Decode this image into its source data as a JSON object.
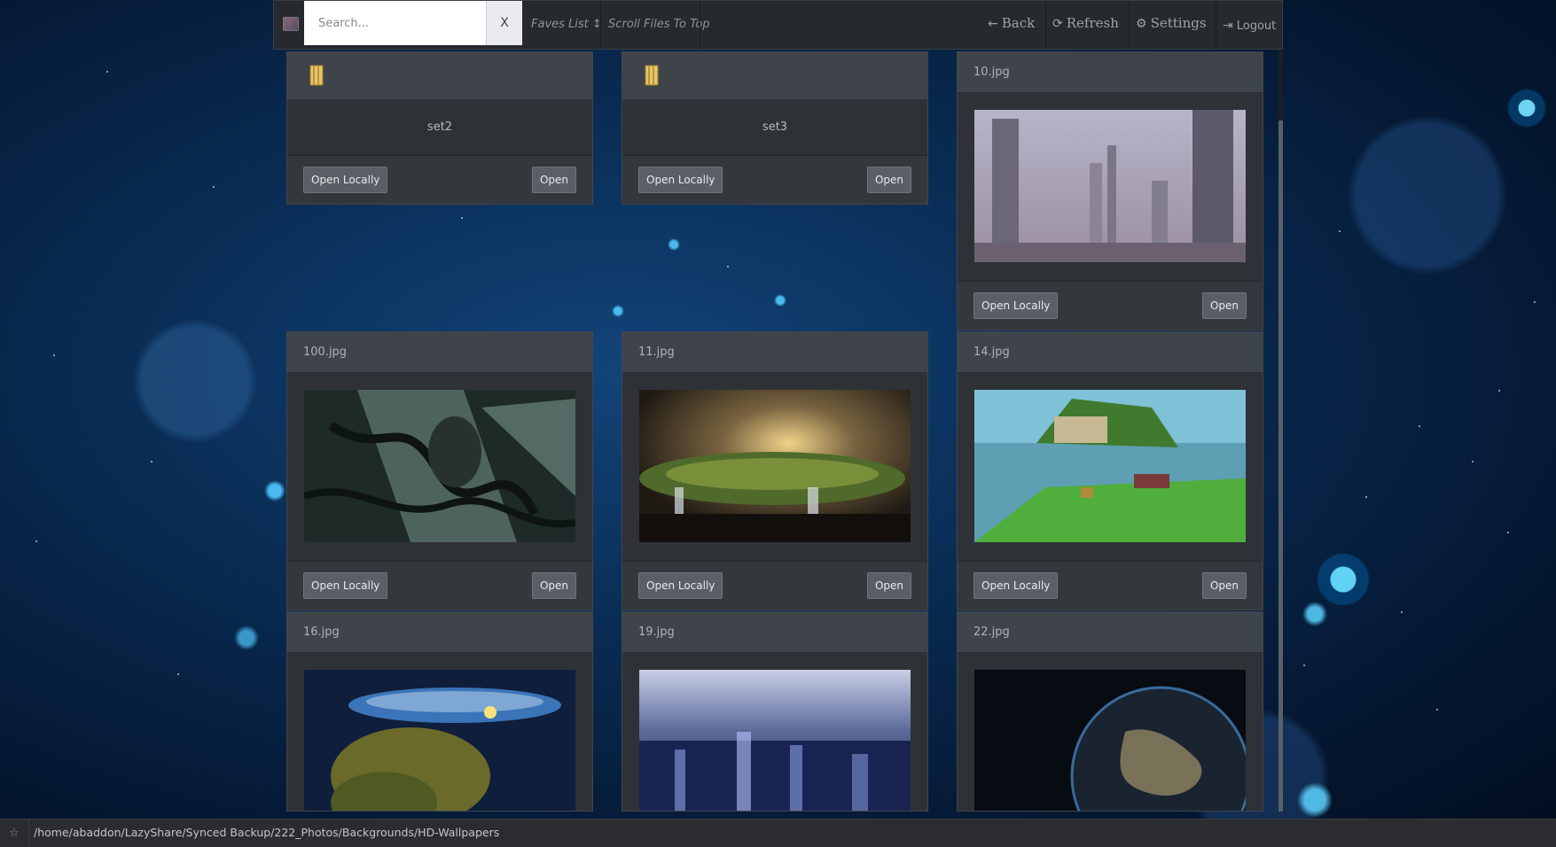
{
  "nav": {
    "search_placeholder": "Search...",
    "clear_label": "X",
    "faves_label": "Faves List ↕",
    "scroll_top_label": "Scroll Files To Top",
    "back_label": "Back",
    "refresh_label": "Refresh",
    "settings_label": "Settings",
    "logout_label": "Logout",
    "icons": {
      "back": "arrow-left-icon",
      "refresh": "refresh-icon",
      "settings": "gear-icon",
      "logout": "logout-icon"
    }
  },
  "cards": [
    {
      "kind": "folder",
      "name": "set2",
      "open_locally": "Open Locally",
      "open": "Open"
    },
    {
      "kind": "folder",
      "name": "set3",
      "open_locally": "Open Locally",
      "open": "Open"
    },
    {
      "kind": "image",
      "name": "10.jpg",
      "scene": "futuristic-city",
      "open_locally": "Open Locally",
      "open": "Open"
    },
    {
      "kind": "image",
      "name": "100.jpg",
      "scene": "dark-forest",
      "open_locally": "Open Locally",
      "open": "Open"
    },
    {
      "kind": "image",
      "name": "11.jpg",
      "scene": "floating-island",
      "open_locally": "Open Locally",
      "open": "Open"
    },
    {
      "kind": "image",
      "name": "14.jpg",
      "scene": "minecraft-island",
      "open_locally": "Open Locally",
      "open": "Open"
    },
    {
      "kind": "image",
      "name": "16.jpg",
      "scene": "discworld-turtle"
    },
    {
      "kind": "image",
      "name": "19.jpg",
      "scene": "night-city"
    },
    {
      "kind": "image",
      "name": "22.jpg",
      "scene": "earth-night"
    }
  ],
  "status": {
    "path": "/home/abaddon/LazyShare/Synced Backup/222_Photos/Backgrounds/HD-Wallpapers",
    "favorite_icon": "star-icon"
  }
}
